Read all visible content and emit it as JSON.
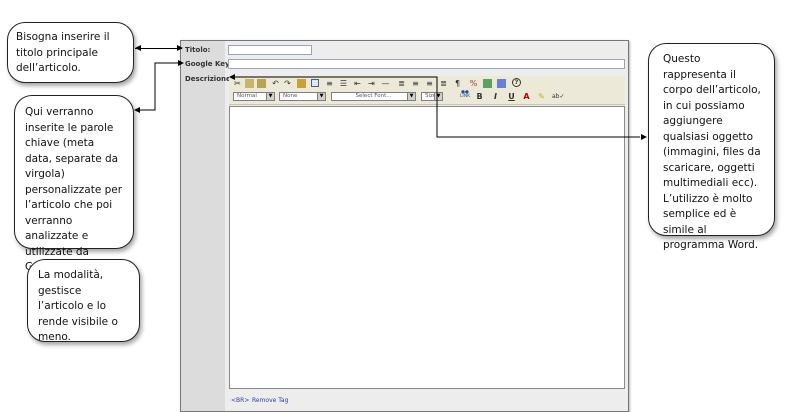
{
  "callouts": {
    "title_note": "Bisogna inserire il titolo principale dell’articolo.",
    "keywords_note": "Qui verranno inserite le parole chiave (meta data, separate da virgola) personalizzate per l’articolo che poi verranno analizzate e utilizzate da Google.",
    "mode_note": "La modalità, gestisce l’articolo e lo rende visibile o meno.",
    "body_note": "Questo rappresenta il corpo dell’articolo, in cui possiamo aggiungere qualsiasi oggetto (immagini, files da scaricare, oggetti multimediali ecc). L’utilizzo è molto semplice ed è simile al programma Word."
  },
  "form": {
    "title_label": "Titolo:",
    "google_key_label": "Google Key:",
    "description_label": "Descrizione:",
    "title_value": "",
    "google_key_value": ""
  },
  "toolbar": {
    "format_select": "Normal",
    "style_select": "None",
    "font_select": "Select Font...",
    "size_select": "Size",
    "bold": "B",
    "italic": "I",
    "underline": "U",
    "font_color": "A",
    "link_label": "LINK",
    "help": "?"
  },
  "editor": {
    "br_link": "<BR>",
    "remove_tag_link": "Remove Tag"
  }
}
